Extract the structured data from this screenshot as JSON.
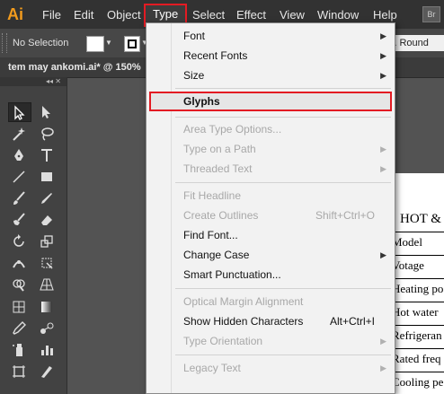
{
  "app": {
    "logo": "Ai"
  },
  "menubar": {
    "items": [
      "File",
      "Edit",
      "Object",
      "Type",
      "Select",
      "Effect",
      "View",
      "Window",
      "Help"
    ],
    "active": "Type",
    "bridge_label": "Br"
  },
  "controlbar": {
    "selection_label": "No Selection",
    "stroke_value": "5 pt. Round"
  },
  "document": {
    "tab_title": "tem may ankomi.ai* @ 150%"
  },
  "artboard": {
    "heading": "HOT &",
    "rows": [
      "Model",
      "Votage",
      "Heating po",
      "Hot water",
      "Refrigeran",
      "Rated freq",
      "Cooling pe"
    ]
  },
  "type_menu": {
    "items": [
      {
        "label": "Font",
        "submenu": true,
        "enabled": true
      },
      {
        "label": "Recent Fonts",
        "submenu": true,
        "enabled": true
      },
      {
        "label": "Size",
        "submenu": true,
        "enabled": true
      },
      {
        "label": "Glyphs",
        "enabled": true,
        "highlighted": true
      },
      {
        "label": "Area Type Options...",
        "enabled": false
      },
      {
        "label": "Type on a Path",
        "submenu": true,
        "enabled": false
      },
      {
        "label": "Threaded Text",
        "submenu": true,
        "enabled": false
      },
      {
        "label": "Fit Headline",
        "enabled": false
      },
      {
        "label": "Create Outlines",
        "shortcut": "Shift+Ctrl+O",
        "enabled": false
      },
      {
        "label": "Find Font...",
        "enabled": true
      },
      {
        "label": "Change Case",
        "submenu": true,
        "enabled": true
      },
      {
        "label": "Smart Punctuation...",
        "enabled": true
      },
      {
        "label": "Optical Margin Alignment",
        "enabled": false
      },
      {
        "label": "Show Hidden Characters",
        "shortcut": "Alt+Ctrl+I",
        "enabled": true
      },
      {
        "label": "Type Orientation",
        "submenu": true,
        "enabled": false
      },
      {
        "label": "Legacy Text",
        "submenu": true,
        "enabled": false
      }
    ]
  },
  "tools": [
    "selection-tool",
    "direct-selection-tool",
    "magic-wand-tool",
    "lasso-tool",
    "pen-tool",
    "type-tool",
    "line-segment-tool",
    "rectangle-tool",
    "paintbrush-tool",
    "pencil-tool",
    "blob-brush-tool",
    "eraser-tool",
    "rotate-tool",
    "scale-tool",
    "width-tool",
    "free-transform-tool",
    "shape-builder-tool",
    "perspective-grid-tool",
    "mesh-tool",
    "gradient-tool",
    "eyedropper-tool",
    "blend-tool",
    "symbol-sprayer-tool",
    "column-graph-tool",
    "artboard-tool",
    "slice-tool"
  ]
}
